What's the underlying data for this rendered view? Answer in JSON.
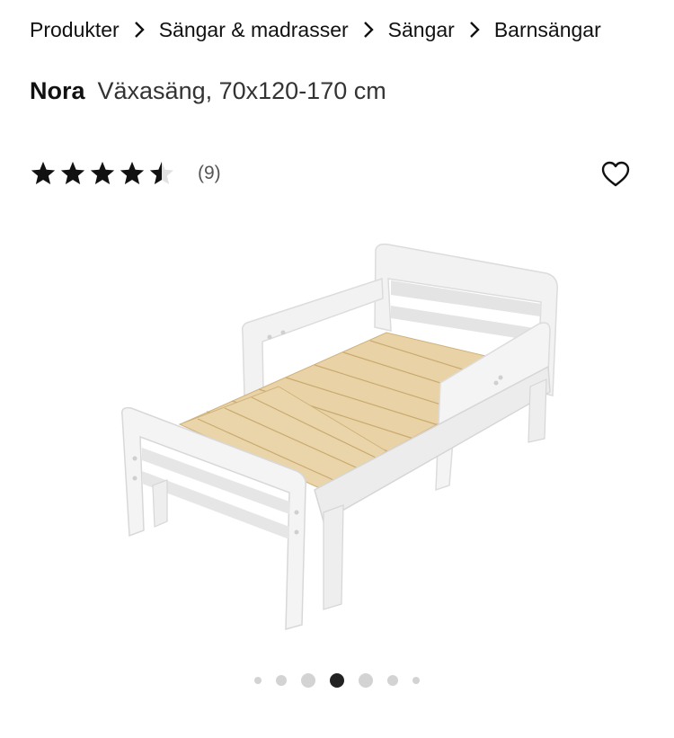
{
  "breadcrumb": {
    "items": [
      "Produkter",
      "Sängar & madrasser",
      "Sängar",
      "Barnsängar"
    ]
  },
  "product": {
    "name": "Nora",
    "description": "Växasäng, 70x120-170 cm"
  },
  "rating": {
    "value": 4.5,
    "max": 5,
    "count_label": "(9)"
  },
  "icons": {
    "breadcrumb_separator": "chevron-right-icon",
    "favorite": "heart-outline-icon",
    "star": "star-icon"
  },
  "gallery": {
    "image_count": 7,
    "active_index": 3
  },
  "colors": {
    "text": "#111111",
    "star": "#111111",
    "dot_inactive": "#d3d3d3",
    "dot_active": "#222222",
    "bed_frame": "#f0f0f0",
    "bed_slats": "#e9d3a6"
  }
}
